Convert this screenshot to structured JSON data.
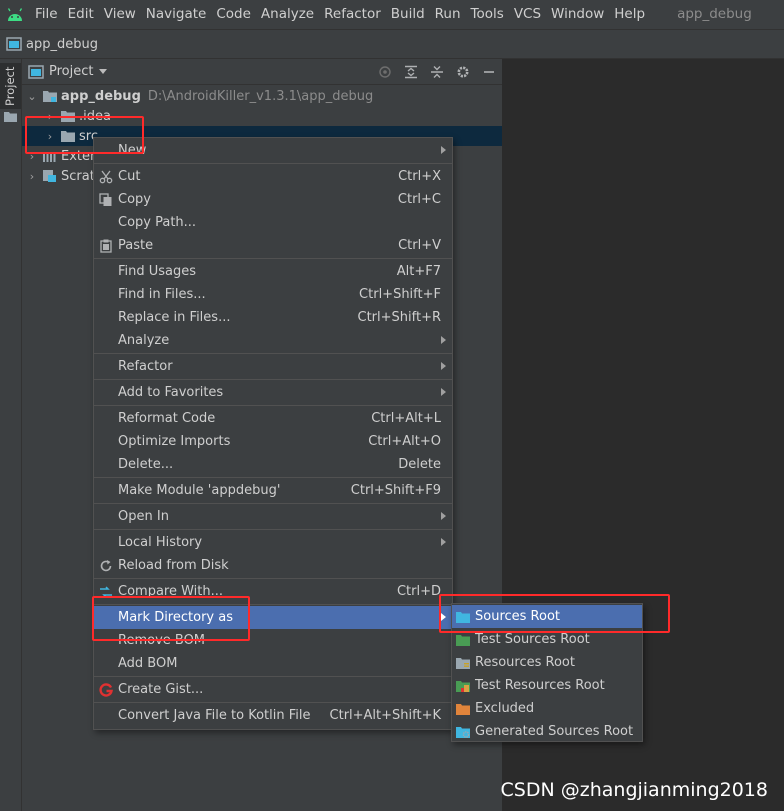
{
  "menubar": {
    "items": [
      "File",
      "Edit",
      "View",
      "Navigate",
      "Code",
      "Analyze",
      "Refactor",
      "Build",
      "Run",
      "Tools",
      "VCS",
      "Window",
      "Help"
    ],
    "app_title": "app_debug"
  },
  "navbar": {
    "breadcrumb": "app_debug"
  },
  "stripe": {
    "tab": "Project"
  },
  "panel": {
    "title": "Project",
    "tools": [
      "target-icon",
      "expand-all-icon",
      "collapse-all-icon",
      "gear-icon",
      "minimize-icon"
    ]
  },
  "tree": {
    "root": {
      "name": "app_debug",
      "path": "D:\\AndroidKiller_v1.3.1\\app_debug"
    },
    "idea": ".idea",
    "src": "src",
    "external": "Exter",
    "scratches": "Scrat"
  },
  "context_menu": {
    "items": [
      {
        "label": "New",
        "shortcut": "",
        "submenu": true
      },
      {
        "label": "Cut",
        "shortcut": "Ctrl+X",
        "icon": "scissors-icon"
      },
      {
        "label": "Copy",
        "shortcut": "Ctrl+C",
        "icon": "copy-icon"
      },
      {
        "label": "Copy Path...",
        "shortcut": ""
      },
      {
        "label": "Paste",
        "shortcut": "Ctrl+V",
        "icon": "clipboard-icon"
      },
      {
        "label": "Find Usages",
        "shortcut": "Alt+F7"
      },
      {
        "label": "Find in Files...",
        "shortcut": "Ctrl+Shift+F"
      },
      {
        "label": "Replace in Files...",
        "shortcut": "Ctrl+Shift+R"
      },
      {
        "label": "Analyze",
        "shortcut": "",
        "submenu": true
      },
      {
        "label": "Refactor",
        "shortcut": "",
        "submenu": true
      },
      {
        "label": "Add to Favorites",
        "shortcut": "",
        "submenu": true
      },
      {
        "label": "Reformat Code",
        "shortcut": "Ctrl+Alt+L"
      },
      {
        "label": "Optimize Imports",
        "shortcut": "Ctrl+Alt+O"
      },
      {
        "label": "Delete...",
        "shortcut": "Delete"
      },
      {
        "label": "Make Module 'appdebug'",
        "shortcut": "Ctrl+Shift+F9"
      },
      {
        "label": "Open In",
        "shortcut": "",
        "submenu": true
      },
      {
        "label": "Local History",
        "shortcut": "",
        "submenu": true
      },
      {
        "label": "Reload from Disk",
        "shortcut": "",
        "icon": "reload-icon"
      },
      {
        "label": "Compare With...",
        "shortcut": "Ctrl+D",
        "icon": "compare-icon"
      },
      {
        "label": "Mark Directory as",
        "shortcut": "",
        "submenu": true,
        "active": true
      },
      {
        "label": "Remove BOM",
        "shortcut": ""
      },
      {
        "label": "Add BOM",
        "shortcut": ""
      },
      {
        "label": "Create Gist...",
        "shortcut": "",
        "icon": "gist-icon"
      },
      {
        "label": "Convert Java File to Kotlin File",
        "shortcut": "Ctrl+Alt+Shift+K"
      }
    ]
  },
  "submenu": {
    "items": [
      {
        "label": "Sources Root",
        "active": true
      },
      {
        "label": "Test Sources Root"
      },
      {
        "label": "Resources Root"
      },
      {
        "label": "Test Resources Root"
      },
      {
        "label": "Excluded"
      },
      {
        "label": "Generated Sources Root"
      }
    ]
  },
  "watermark": "CSDN @zhangjianming2018",
  "colors": {
    "menu_bg": "#3c3f41",
    "editor_bg": "#2b2b2b",
    "selection": "#4b6eaf",
    "tree_selection": "#0d293e",
    "annotation": "#ff2a2a"
  }
}
